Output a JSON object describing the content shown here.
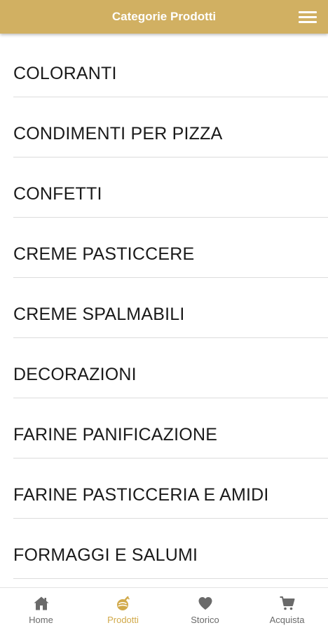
{
  "header": {
    "title": "Categorie Prodotti",
    "background_color": "#d1b062",
    "menu_icon": "hamburger-menu-icon"
  },
  "categories": [
    {
      "label": "COLORANTI"
    },
    {
      "label": "CONDIMENTI PER PIZZA"
    },
    {
      "label": "CONFETTI"
    },
    {
      "label": "CREME PASTICCERE"
    },
    {
      "label": "CREME SPALMABILI"
    },
    {
      "label": "DECORAZIONI"
    },
    {
      "label": "FARINE PANIFICAZIONE"
    },
    {
      "label": "FARINE PASTICCERIA E AMIDI"
    },
    {
      "label": "FORMAGGI E SALUMI"
    }
  ],
  "bottom_nav": {
    "active_color": "#d1a94a",
    "inactive_color": "#6a6a6a",
    "items": [
      {
        "label": "Home",
        "icon": "home-icon",
        "active": false
      },
      {
        "label": "Prodotti",
        "icon": "products-icon",
        "active": true
      },
      {
        "label": "Storico",
        "icon": "heart-icon",
        "active": false
      },
      {
        "label": "Acquista",
        "icon": "cart-icon",
        "active": false
      }
    ]
  }
}
